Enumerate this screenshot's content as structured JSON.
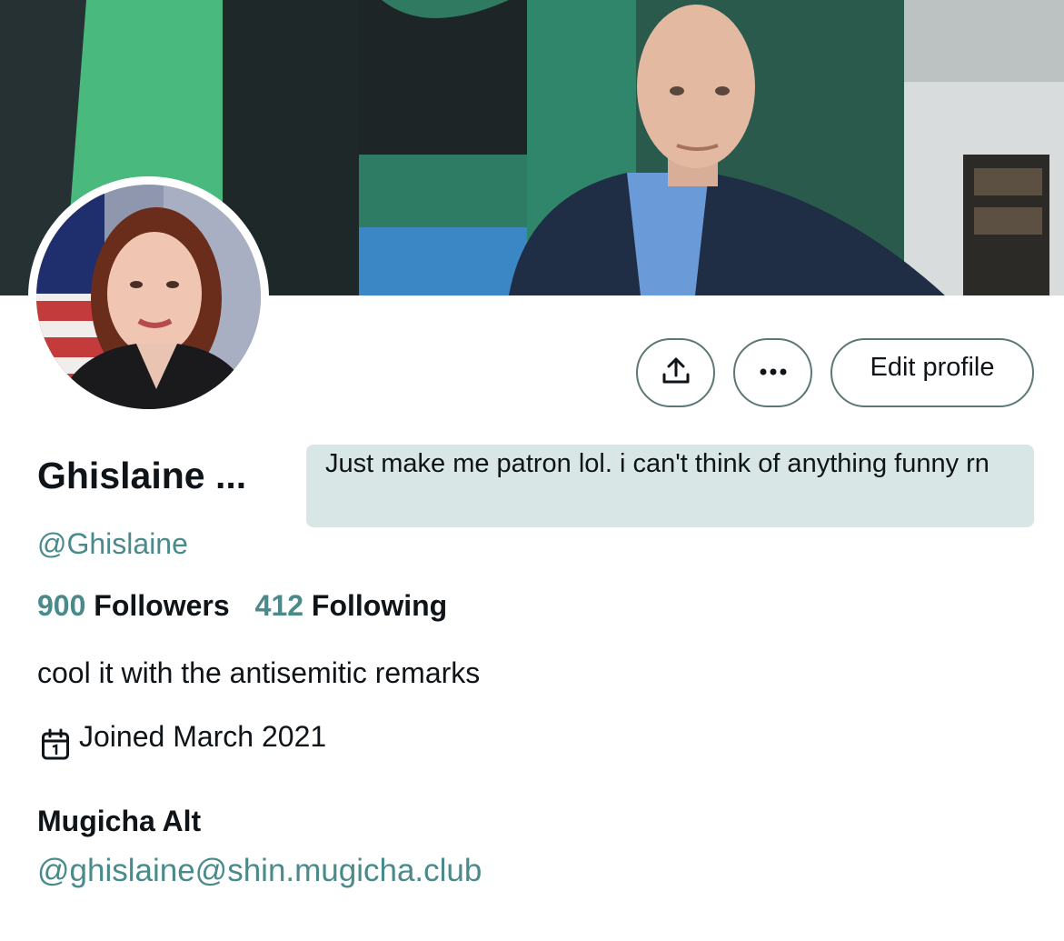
{
  "profile": {
    "display_name": "Ghislaine ...",
    "handle": "@Ghislaine",
    "note": "Just make me patron lol. i can't think of anything funny rn",
    "bio": "cool it with the antisemitic remarks",
    "joined": "Joined March 2021"
  },
  "stats": {
    "followers_count": "900",
    "followers_label": "Followers",
    "following_count": "412",
    "following_label": "Following"
  },
  "actions": {
    "share_icon": "share-icon",
    "more_icon": "more-icon",
    "edit_label": "Edit profile"
  },
  "fields": [
    {
      "label": "Mugicha Alt",
      "value": "@ghislaine@shin.mugicha.club"
    }
  ],
  "colors": {
    "accent": "#4a8a8a",
    "note_background": "#d9e6e6",
    "button_border": "#5c7775"
  }
}
